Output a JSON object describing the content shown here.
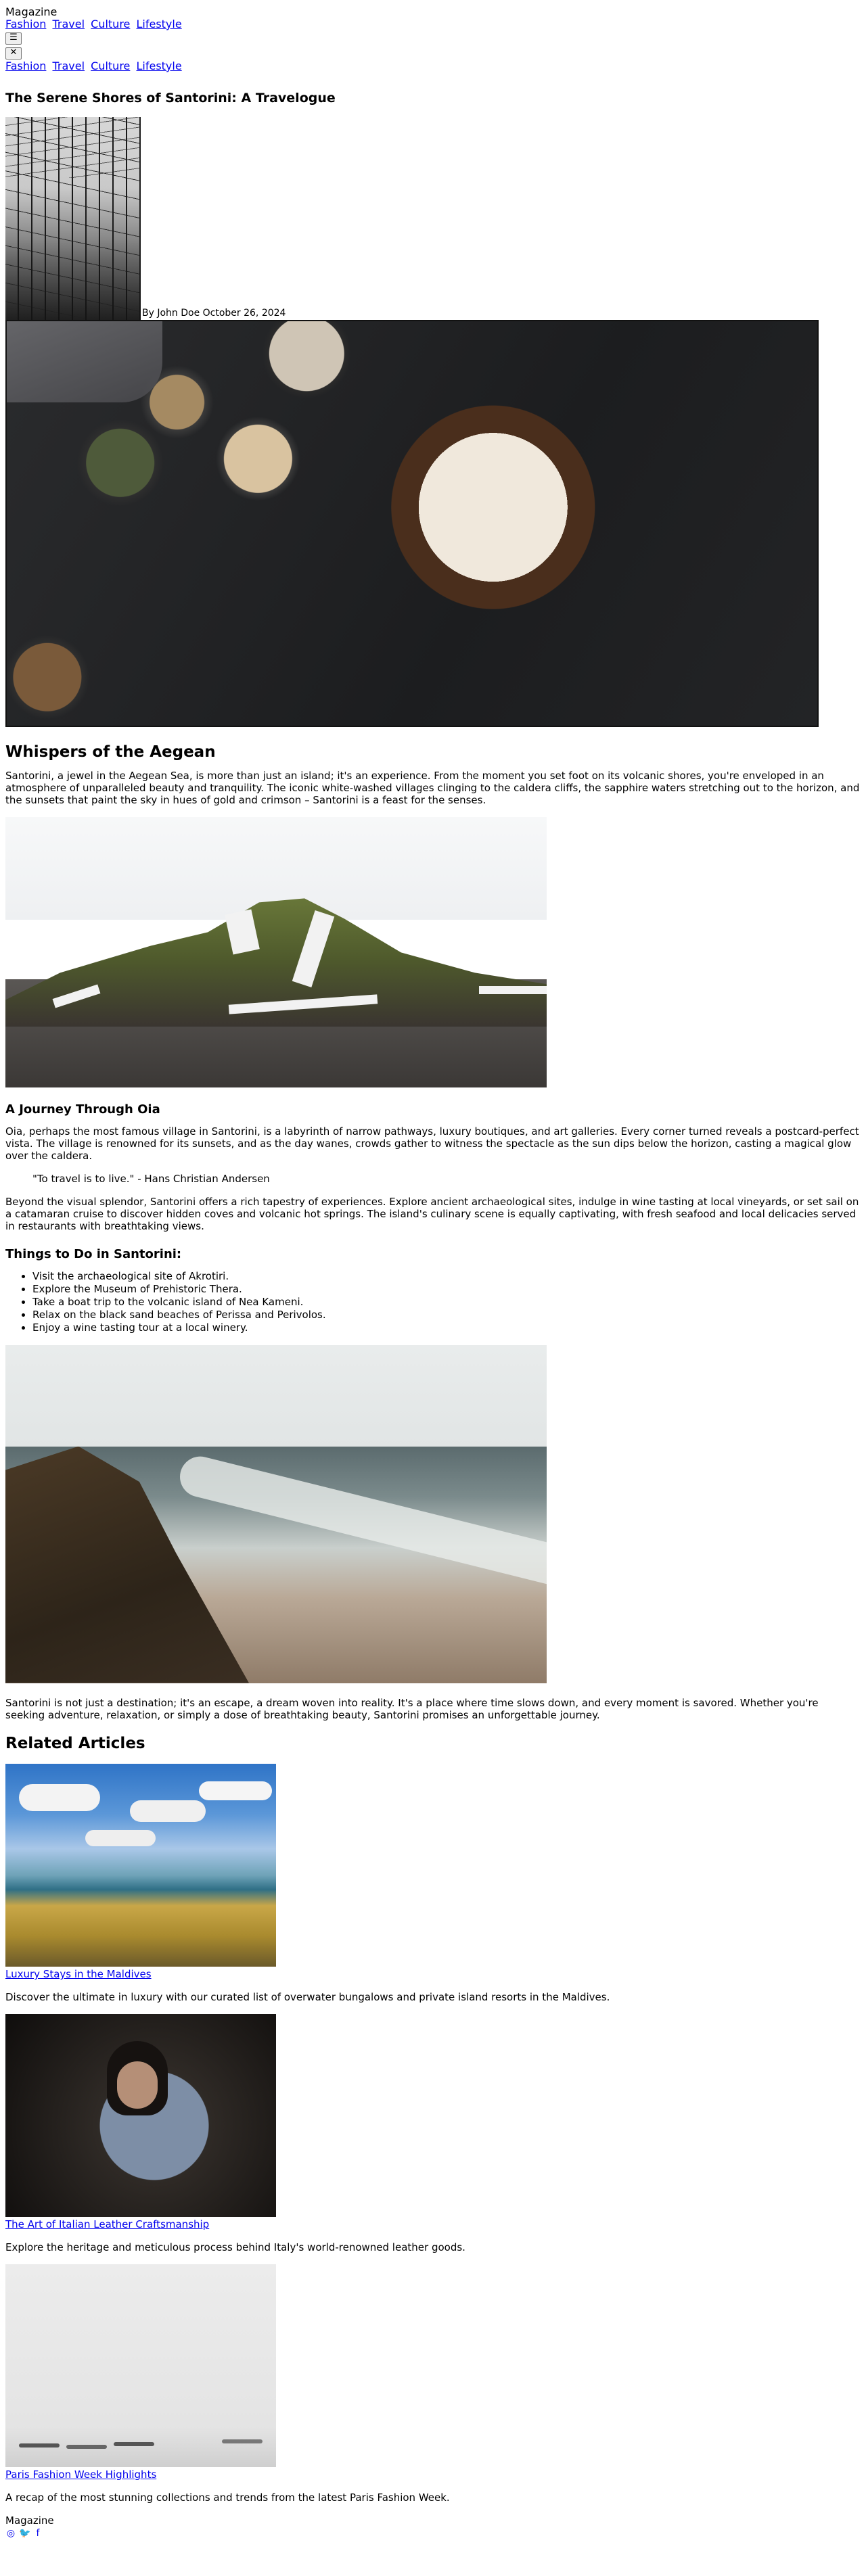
{
  "header": {
    "brand": "Magazine",
    "nav": [
      "Fashion",
      "Travel",
      "Culture",
      "Lifestyle"
    ],
    "menu_icon": "hamburger-menu-icon",
    "close_icon": "close-icon",
    "mobile_nav": [
      "Fashion",
      "Travel",
      "Culture",
      "Lifestyle"
    ]
  },
  "article": {
    "title": "The Serene Shores of Santorini: A Travelogue",
    "byline": "By John Doe October 26, 2024",
    "section1_heading": "Whispers of the Aegean",
    "section1_text": "Santorini, a jewel in the Aegean Sea, is more than just an island; it's an experience. From the moment you set foot on its volcanic shores, you're enveloped in an atmosphere of unparalleled beauty and tranquility. The iconic white-washed villages clinging to the caldera cliffs, the sapphire waters stretching out to the horizon, and the sunsets that paint the sky in hues of gold and crimson – Santorini is a feast for the senses.",
    "section2_heading": "A Journey Through Oia",
    "section2_text": "Oia, perhaps the most famous village in Santorini, is a labyrinth of narrow pathways, luxury boutiques, and art galleries. Every corner turned reveals a postcard-perfect vista. The village is renowned for its sunsets, and as the day wanes, crowds gather to witness the spectacle as the sun dips below the horizon, casting a magical glow over the caldera.",
    "quote": "\"To travel is to live.\" - Hans Christian Andersen",
    "section3_text": "Beyond the visual splendor, Santorini offers a rich tapestry of experiences. Explore ancient archaeological sites, indulge in wine tasting at local vineyards, or set sail on a catamaran cruise to discover hidden coves and volcanic hot springs. The island's culinary scene is equally captivating, with fresh seafood and local delicacies served in restaurants with breathtaking views.",
    "todo_heading": "Things to Do in Santorini:",
    "todo": [
      "Visit the archaeological site of Akrotiri.",
      "Explore the Museum of Prehistoric Thera.",
      "Take a boat trip to the volcanic island of Nea Kameni.",
      "Relax on the black sand beaches of Perissa and Perivolos.",
      "Enjoy a wine tasting tour at a local winery."
    ],
    "closing_text": "Santorini is not just a destination; it's an escape, a dream woven into reality. It's a place where time slows down, and every moment is savored. Whether you're seeking adventure, relaxation, or simply a dose of breathtaking beauty, Santorini promises an unforgettable journey."
  },
  "related": {
    "heading": "Related Articles",
    "items": [
      {
        "title": "Luxury Stays in the Maldives",
        "desc": "Discover the ultimate in luxury with our curated list of overwater bungalows and private island resorts in the Maldives."
      },
      {
        "title": "The Art of Italian Leather Craftsmanship",
        "desc": "Explore the heritage and meticulous process behind Italy's world-renowned leather goods."
      },
      {
        "title": "Paris Fashion Week Highlights",
        "desc": "A recap of the most stunning collections and trends from the latest Paris Fashion Week."
      }
    ]
  },
  "footer": {
    "brand": "Magazine",
    "social_icons": [
      "instagram-icon",
      "twitter-icon",
      "facebook-icon"
    ]
  }
}
